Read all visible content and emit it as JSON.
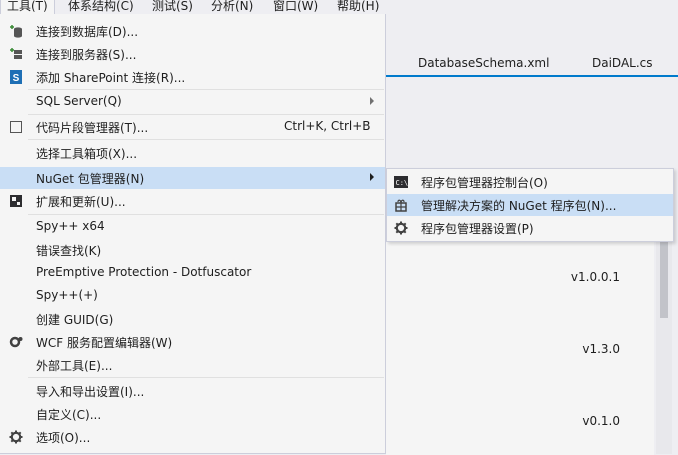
{
  "menubar": {
    "items": [
      {
        "label": "工具(T)",
        "active": true
      },
      {
        "label": "体系结构(C)"
      },
      {
        "label": "测试(S)"
      },
      {
        "label": "分析(N)"
      },
      {
        "label": "窗口(W)"
      },
      {
        "label": "帮助(H)"
      }
    ]
  },
  "editor": {
    "tabs": [
      "DatabaseSchema.xml",
      "DaiDAL.cs"
    ],
    "versions": [
      "v1.0.0.1",
      "v1.3.0",
      "v0.1.0"
    ]
  },
  "tools_menu": {
    "items": [
      {
        "label": "连接到数据库(D)...",
        "icon": "connect-database-icon"
      },
      {
        "label": "连接到服务器(S)...",
        "icon": "connect-server-icon"
      },
      {
        "label": "添加 SharePoint 连接(R)...",
        "icon": "sharepoint-icon"
      },
      {
        "label": "SQL Server(Q)",
        "submenu": true
      },
      {
        "label": "代码片段管理器(T)...",
        "shortcut": "Ctrl+K, Ctrl+B",
        "icon": "code-snippet-icon"
      },
      {
        "label": "选择工具箱项(X)..."
      },
      {
        "label": "NuGet 包管理器(N)",
        "submenu": true,
        "highlighted": true
      },
      {
        "label": "扩展和更新(U)...",
        "icon": "extensions-icon"
      },
      {
        "label": "Spy++ x64"
      },
      {
        "label": "错误查找(K)"
      },
      {
        "label": "PreEmptive Protection - Dotfuscator"
      },
      {
        "label": "Spy++(+)"
      },
      {
        "label": "创建 GUID(G)"
      },
      {
        "label": "WCF 服务配置编辑器(W)",
        "icon": "wcf-config-icon"
      },
      {
        "label": "外部工具(E)..."
      },
      {
        "label": "导入和导出设置(I)..."
      },
      {
        "label": "自定义(C)..."
      },
      {
        "label": "选项(O)...",
        "icon": "gear-icon"
      }
    ]
  },
  "nuget_submenu": {
    "items": [
      {
        "label": "程序包管理器控制台(O)",
        "icon": "console-icon"
      },
      {
        "label": "管理解决方案的 NuGet 程序包(N)...",
        "icon": "nuget-package-icon",
        "highlighted": true
      },
      {
        "label": "程序包管理器设置(P)",
        "icon": "gear-icon"
      }
    ]
  },
  "colors": {
    "highlight": "#c9def5",
    "menu_bg": "#f5f5f5",
    "accent": "#007acc"
  }
}
